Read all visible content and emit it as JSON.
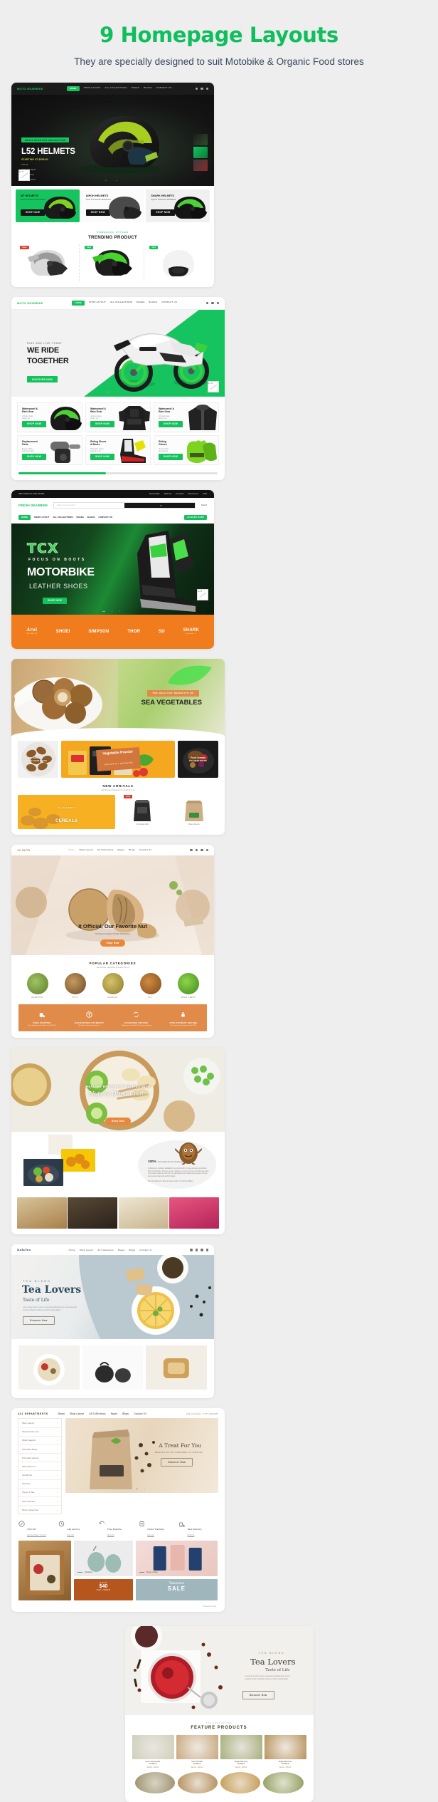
{
  "header": {
    "title": "9 Homepage Layouts",
    "subtitle": "They are specially designed to suit Motobike & Organic Food stores",
    "title_color": "#0fbe5c",
    "subtitle_color": "#35495e"
  },
  "common_nav": {
    "items": [
      "HOME",
      "SHOP LAYOUT",
      "ALL COLLECTIONS",
      "PAGES",
      "BLOGS",
      "CONTACT US"
    ],
    "icons": [
      "search-icon",
      "cart-icon",
      "menu-icon"
    ]
  },
  "layout1": {
    "logo": "MOTO GEARBIKE",
    "nav": [
      "HOME",
      "SHOP LAYOUT",
      "ALL COLLECTIONS",
      "PAGES",
      "BLOGS",
      "CONTACT US"
    ],
    "hero": {
      "tag": "MEN'S SPORTIVE COLLECTION",
      "title": "L52 HELMETS",
      "subtitle": "STARTING AT $250.00",
      "lines": [
        "The 37",
        "MOT OX Sport",
        "Hybrid heavy",
        "riding provides"
      ],
      "counter": "1 / 3"
    },
    "brand_cards": [
      {
        "title": "MT HELMETS",
        "sub": "Sport & Protection Redefined",
        "button": "SHOP NOW",
        "bg": "#16c45f",
        "fg": "#06260f"
      },
      {
        "title": "AIROH HELMETS",
        "sub": "Sport & Protection Redefined",
        "button": "SHOP NOW",
        "bg": "#fafafa",
        "fg": "#1c1c1c"
      },
      {
        "title": "SHARK HELMETS",
        "sub": "Sport & Protection Redefined",
        "button": "SHOP NOW",
        "bg": "#f0f0f0",
        "fg": "#1c1c1c"
      }
    ],
    "section": {
      "kicker": "POWERFUL STYLES",
      "title": "TRENDING PRODUCT"
    },
    "products": [
      {
        "tag": "SALE",
        "tag_color": "#e7392f"
      },
      {
        "tag": "NEW",
        "tag_color": "#16c45f"
      },
      {
        "tag": "-30%",
        "tag_color": "#16c45f"
      }
    ]
  },
  "layout2": {
    "logo": "MOTO GEARBIKE",
    "nav": [
      "HOME",
      "SHOP LAYOUT",
      "ALL COLLECTIONS",
      "PAGES",
      "BLOGS",
      "CONTACT US"
    ],
    "hero": {
      "kicker": "RIDE AND LIVE TODAY",
      "title_line1": "WE RIDE",
      "title_line2": "TOGETHER",
      "button": "DISCOVER NOW",
      "counter": "1 / 3"
    },
    "categories": [
      {
        "title": "Waterproof &\nRain Gear",
        "sub": "Includes bags,\nboxes, etc",
        "button": "SHOP NOW"
      },
      {
        "title": "Waterproof &\nRain Gear",
        "sub": "Includes bags,\nboxes, etc",
        "button": "SHOP NOW"
      },
      {
        "title": "Waterproof &\nRain Gear",
        "sub": "Includes bags,\nboxes, etc",
        "button": "SHOP NOW"
      },
      {
        "title": "Replacement\nParts",
        "sub": "Brakes, MFG\nand basic parts",
        "button": "SHOP NOW"
      },
      {
        "title": "Riding Shoes\n& Boots",
        "sub": "Protective shoes,\npants & more",
        "button": "SHOP NOW"
      },
      {
        "title": "Riding\nGloves",
        "sub": "All important\naccessories",
        "button": "SHOP NOW"
      }
    ]
  },
  "layout3": {
    "topbar_left": "WELCOME TO OUR STORE",
    "topbar_right": [
      "Need Help?",
      "Wish list",
      "Compare",
      "My Account",
      "USD"
    ],
    "logo": "FRESH GEARBIKE",
    "search_placeholder": "Enter your keyword...",
    "cart_label": "Cart   0",
    "nav": [
      "HOME",
      "SHOP LAYOUT",
      "ALL COLLECTIONS",
      "PAGES",
      "BLOGS",
      "CONTACT US"
    ],
    "phone_button": "+44 20 817 12407",
    "hero": {
      "brand": "TCX",
      "tagline": "FOCUS ON BOOTS",
      "title": "MOTORBIKE",
      "subtitle": "LEATHER SHOES",
      "button": "SHOP NOW"
    },
    "brands": [
      {
        "name": "Arai",
        "sub": "HELMETS"
      },
      {
        "name": "SHOEI",
        "sub": ""
      },
      {
        "name": "SIMPSON",
        "sub": ""
      },
      {
        "name": "THOR",
        "sub": ""
      },
      {
        "name": "SD",
        "sub": ""
      },
      {
        "name": "SHARK",
        "sub": "HELMETS"
      }
    ]
  },
  "layout4": {
    "hero": {
      "tag": "THE HEALTHY BENEFITS OF",
      "title": "SEA VEGETABLES"
    },
    "promos": [
      {
        "title": "Almonds",
        "sub": "SALE UP TO 30% OFF"
      },
      {
        "title": "Vegetable Powder",
        "sub": "30% OFF ALL PRODUCTS"
      },
      {
        "title": "Fruit Cereals",
        "sub": "SALE UP TO 30% OFF"
      }
    ],
    "new_arrivals": {
      "title": "NEW ARRIVALS",
      "sub": "Add Popular Categories to weekly line up"
    },
    "arrivals": [
      {
        "name": "Coated Milly\nCEREALS",
        "tag": ""
      },
      {
        "name": "Chia Seeds 200g",
        "price": "$18.00",
        "tag": "SALE"
      },
      {
        "name": "Walnut Kernels",
        "price": "$22.00",
        "tag": ""
      }
    ]
  },
  "layout5": {
    "logo": "JK NUTS",
    "nav": [
      "Home",
      "Shop Layout",
      "All Collections",
      "Pages",
      "Blogs",
      "Contact Us"
    ],
    "hero": {
      "title": "It Official, Our Favorite Nut",
      "sub": "Roasted & Salted Turkish Pistachios",
      "button": "Shop Now"
    },
    "section": {
      "title": "POPULAR CATEGORIES",
      "sub": "Add Popular Categories to weekly line up"
    },
    "categories": [
      {
        "label": "GREENTEA"
      },
      {
        "label": "NUTS"
      },
      {
        "label": "CEREALS"
      },
      {
        "label": "NUT"
      },
      {
        "label": "DRIED SEEDS"
      }
    ],
    "features": [
      {
        "title": "FREE SHIPPING",
        "sub": "Free shipping on all orders over $100.00"
      },
      {
        "title": "GUARANTEED PAYMENTS",
        "sub": "We offer flexible payment plans"
      },
      {
        "title": "EXCHANGE RETURN",
        "sub": "Simply return it within 30 days for exchange"
      },
      {
        "title": "100% PAYMENT SECURE",
        "sub": "We ensure secure payment with PEV"
      }
    ]
  },
  "layout6": {
    "hero": {
      "kicker": "HEALTHY BREAKFAST RECIPES WITH",
      "title": "Nuts & Dried Fruits",
      "sub": "WE MAKE SURE THAT YOUR HEALTHY MEAL NEEDS",
      "button": "Shop Now"
    },
    "about": {
      "percent": "100%",
      "headline": "Committed To Our Customers",
      "paragraph1": "At Nuts.com, customer satisfaction is our top priority. If you experience a problem with our products, customer service, shipping, or even if you just don't like the snack you bought, please let us know. Our generations-old, family-owned values that you deserve personal service that's happy.",
      "paragraph2": "We'd do whatever it takes to make it right. It's a family tradition."
    }
  },
  "layout7": {
    "logo": "KalaTea",
    "nav": [
      "Home",
      "Shop Layout",
      "All Collections",
      "Pages",
      "Blogs",
      "Contact Us"
    ],
    "hero": {
      "kicker": "TEA BLEND",
      "title": "Tea Lovers",
      "subtitle": "Taste of Life",
      "paragraph": "Lorem ipsum dolor sit amet, consectetur adipiscing elit, sed do eiusmod tempor incididunt ut labore et dolore magna aliqua.",
      "button": "Discover Now"
    }
  },
  "layout8": {
    "sidebar_title": "ALL DEPARTMENTS",
    "nav": [
      "Home",
      "Shop Layout",
      "All Collections",
      "Pages",
      "Blogs",
      "Contact Us"
    ],
    "phone": "Call us toll free : 1-877-284-4537",
    "sidebar_items": [
      "Shop Layout",
      "Featured & tools",
      "Other teapots",
      "Porcelain Mugs",
      "Porcelain teapots",
      "Shop Must Go",
      "Tea Sticks",
      "Teaware",
      "Types of Tea",
      "New Arrivals",
      "More Categories"
    ],
    "banner": {
      "product_label": "Hotleaf",
      "product_sub": "ORGANIC TEA",
      "title": "A Treat For You",
      "sub": "RECEIVE A 15% GIFT CARD WHEN YOU SPEND $40",
      "button": "Discover Now"
    },
    "services": [
      {
        "title": "10% Off",
        "sub": "Free New Brand : Tea 170"
      },
      {
        "title": "24h service",
        "sub": "More Info"
      },
      {
        "title": "Free Returns",
        "sub": "More Info"
      },
      {
        "title": "Order Tracking",
        "sub": "More Info"
      },
      {
        "title": "Fast Delivery",
        "sub": "More Info"
      }
    ],
    "tiles": [
      {
        "caption": "Teaware"
      },
      {
        "caption": "Types of Tea"
      }
    ],
    "gift": {
      "kicker": "GIFTS",
      "amount": "$40",
      "and_under": "AND UNDER",
      "button": "Shop now"
    },
    "sale": {
      "title": "Teaware",
      "sub": "Perfect for brewing and serving your tea",
      "big": "SALE"
    },
    "footer": "Powered by Vinoli"
  },
  "layout9": {
    "hero": {
      "kicker": "TEA BLEND",
      "title": "Tea Lovers",
      "subtitle": "Taste of Life",
      "paragraph": "Lorem ipsum dolor sit amet, consectetur adipiscing elit, sed do eiusmod tempor incididunt ut labore et dolore magna aliqua.",
      "button": "Discover Now"
    },
    "section": {
      "kicker": "THE BEST OF TEA",
      "title": "FEATURE PRODUCTS"
    },
    "products": [
      {
        "name": "Green Tea Lavender\nTea Blend",
        "price": "$22.00 - $45.00"
      },
      {
        "name": "Green Tea Mint\nTea Blend",
        "price": "$22.00 - $45.00"
      },
      {
        "name": "Organic Earl Grey\nTea Blend",
        "price": "$22.00 - $45.00"
      },
      {
        "name": "Organic Earl Grey\nTea Blend",
        "price": "$22.00 - $45.00"
      }
    ]
  }
}
